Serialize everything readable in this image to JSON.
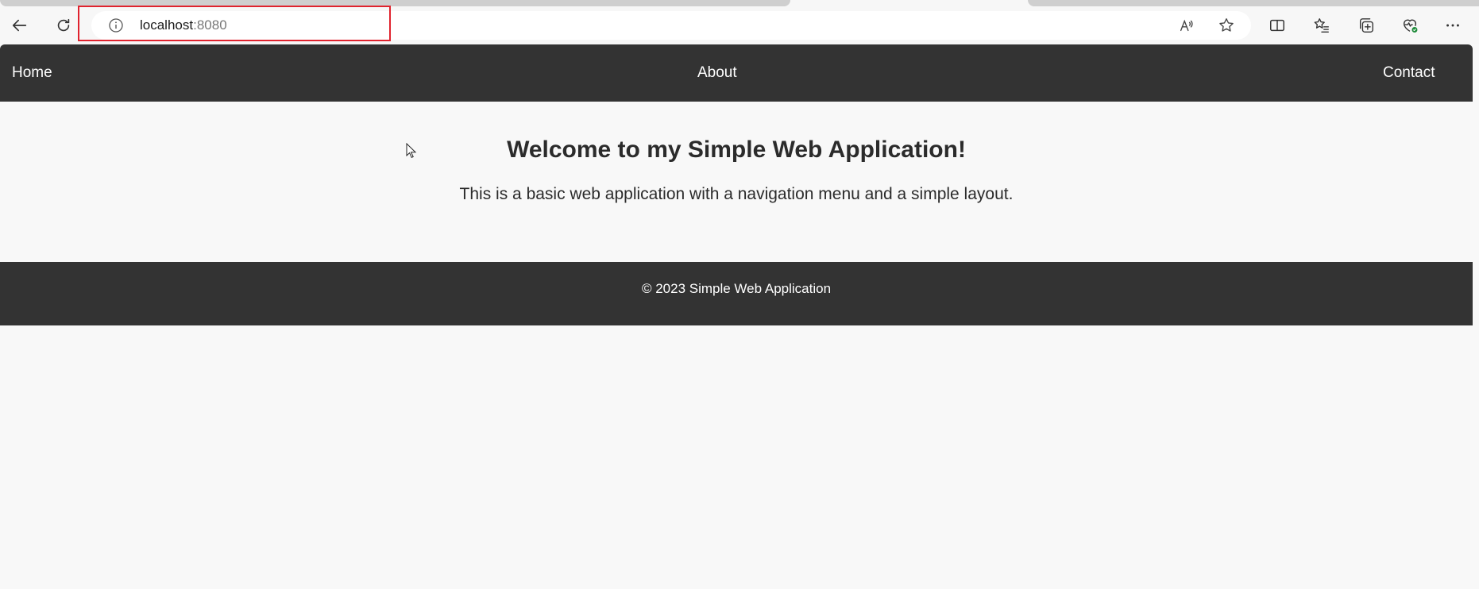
{
  "browser": {
    "url_host": "localhost",
    "url_port": ":8080",
    "icons": {
      "back": "back-arrow-icon",
      "refresh": "refresh-icon",
      "info": "info-icon",
      "read_aloud": "read-aloud-icon",
      "favorite": "star-icon",
      "split_screen": "split-screen-icon",
      "favorites": "favorites-list-icon",
      "collections": "collections-icon",
      "health": "browser-essentials-icon",
      "more": "more-icon"
    }
  },
  "nav": {
    "home": "Home",
    "about": "About",
    "contact": "Contact"
  },
  "main": {
    "heading": "Welcome to my Simple Web Application!",
    "paragraph": "This is a basic web application with a navigation menu and a simple layout."
  },
  "footer": {
    "text": "© 2023 Simple Web Application"
  },
  "colors": {
    "nav_bg": "#333333",
    "footer_bg": "#333333",
    "page_bg": "#f8f8f8",
    "highlight": "#e0232e"
  }
}
